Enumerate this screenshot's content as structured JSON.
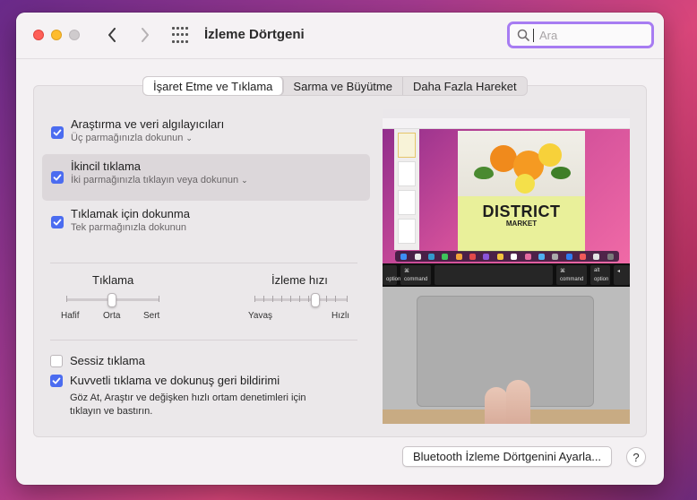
{
  "window": {
    "title": "İzleme Dörtgeni"
  },
  "search": {
    "placeholder": "Ara"
  },
  "tabs": [
    {
      "label": "İşaret Etme ve Tıklama",
      "active": true
    },
    {
      "label": "Sarma ve Büyütme",
      "active": false
    },
    {
      "label": "Daha Fazla Hareket",
      "active": false
    }
  ],
  "options": [
    {
      "title": "Araştırma ve veri algılayıcıları",
      "subtitle": "Üç parmağınızla dokunun",
      "checked": true
    },
    {
      "title": "İkincil tıklama",
      "subtitle": "İki parmağınızla tıklayın veya dokunun",
      "checked": true
    },
    {
      "title": "Tıklamak için dokunma",
      "subtitle": "Tek parmağınızla dokunun",
      "checked": true
    }
  ],
  "sliders": {
    "click": {
      "label": "Tıklama",
      "min_label": "Hafif",
      "mid_label": "Orta",
      "max_label": "Sert",
      "value": "Orta"
    },
    "speed": {
      "label": "İzleme hızı",
      "min_label": "Yavaş",
      "max_label": "Hızlı"
    }
  },
  "checkboxes": {
    "silent": {
      "label": "Sessiz tıklama",
      "checked": false
    },
    "force": {
      "label": "Kuvvetli tıklama ve dokunuş geri bildirimi",
      "checked": true,
      "description": "Göz At, Araştır ve değişken hızlı ortam denetimleri için tıklayın ve bastırın."
    }
  },
  "preview": {
    "poster_title": "DISTRICT",
    "poster_subtitle": "MARKET",
    "keys": {
      "option": "option",
      "command": "command",
      "alt": "alt"
    }
  },
  "footer": {
    "bluetooth_button": "Bluetooth İzleme Dörtgenini Ayarla...",
    "help_label": "?"
  },
  "colors": {
    "accent": "#4b6cf0",
    "search_focus": "#a77cf2"
  }
}
